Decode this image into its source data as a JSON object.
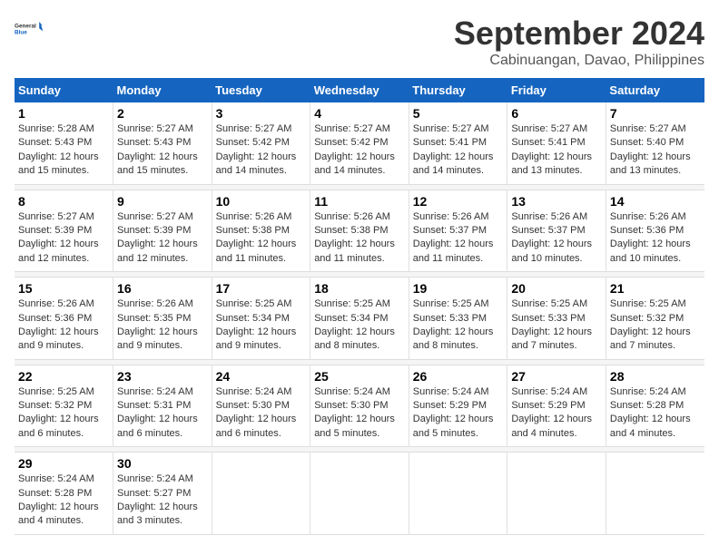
{
  "app": {
    "name": "General",
    "name2": "Blue"
  },
  "title": "September 2024",
  "subtitle": "Cabinuangan, Davao, Philippines",
  "headers": [
    "Sunday",
    "Monday",
    "Tuesday",
    "Wednesday",
    "Thursday",
    "Friday",
    "Saturday"
  ],
  "weeks": [
    [
      {
        "day": "1",
        "sunrise": "Sunrise: 5:28 AM",
        "sunset": "Sunset: 5:43 PM",
        "daylight": "Daylight: 12 hours and 15 minutes."
      },
      {
        "day": "2",
        "sunrise": "Sunrise: 5:27 AM",
        "sunset": "Sunset: 5:43 PM",
        "daylight": "Daylight: 12 hours and 15 minutes."
      },
      {
        "day": "3",
        "sunrise": "Sunrise: 5:27 AM",
        "sunset": "Sunset: 5:42 PM",
        "daylight": "Daylight: 12 hours and 14 minutes."
      },
      {
        "day": "4",
        "sunrise": "Sunrise: 5:27 AM",
        "sunset": "Sunset: 5:42 PM",
        "daylight": "Daylight: 12 hours and 14 minutes."
      },
      {
        "day": "5",
        "sunrise": "Sunrise: 5:27 AM",
        "sunset": "Sunset: 5:41 PM",
        "daylight": "Daylight: 12 hours and 14 minutes."
      },
      {
        "day": "6",
        "sunrise": "Sunrise: 5:27 AM",
        "sunset": "Sunset: 5:41 PM",
        "daylight": "Daylight: 12 hours and 13 minutes."
      },
      {
        "day": "7",
        "sunrise": "Sunrise: 5:27 AM",
        "sunset": "Sunset: 5:40 PM",
        "daylight": "Daylight: 12 hours and 13 minutes."
      }
    ],
    [
      {
        "day": "8",
        "sunrise": "Sunrise: 5:27 AM",
        "sunset": "Sunset: 5:39 PM",
        "daylight": "Daylight: 12 hours and 12 minutes."
      },
      {
        "day": "9",
        "sunrise": "Sunrise: 5:27 AM",
        "sunset": "Sunset: 5:39 PM",
        "daylight": "Daylight: 12 hours and 12 minutes."
      },
      {
        "day": "10",
        "sunrise": "Sunrise: 5:26 AM",
        "sunset": "Sunset: 5:38 PM",
        "daylight": "Daylight: 12 hours and 11 minutes."
      },
      {
        "day": "11",
        "sunrise": "Sunrise: 5:26 AM",
        "sunset": "Sunset: 5:38 PM",
        "daylight": "Daylight: 12 hours and 11 minutes."
      },
      {
        "day": "12",
        "sunrise": "Sunrise: 5:26 AM",
        "sunset": "Sunset: 5:37 PM",
        "daylight": "Daylight: 12 hours and 11 minutes."
      },
      {
        "day": "13",
        "sunrise": "Sunrise: 5:26 AM",
        "sunset": "Sunset: 5:37 PM",
        "daylight": "Daylight: 12 hours and 10 minutes."
      },
      {
        "day": "14",
        "sunrise": "Sunrise: 5:26 AM",
        "sunset": "Sunset: 5:36 PM",
        "daylight": "Daylight: 12 hours and 10 minutes."
      }
    ],
    [
      {
        "day": "15",
        "sunrise": "Sunrise: 5:26 AM",
        "sunset": "Sunset: 5:36 PM",
        "daylight": "Daylight: 12 hours and 9 minutes."
      },
      {
        "day": "16",
        "sunrise": "Sunrise: 5:26 AM",
        "sunset": "Sunset: 5:35 PM",
        "daylight": "Daylight: 12 hours and 9 minutes."
      },
      {
        "day": "17",
        "sunrise": "Sunrise: 5:25 AM",
        "sunset": "Sunset: 5:34 PM",
        "daylight": "Daylight: 12 hours and 9 minutes."
      },
      {
        "day": "18",
        "sunrise": "Sunrise: 5:25 AM",
        "sunset": "Sunset: 5:34 PM",
        "daylight": "Daylight: 12 hours and 8 minutes."
      },
      {
        "day": "19",
        "sunrise": "Sunrise: 5:25 AM",
        "sunset": "Sunset: 5:33 PM",
        "daylight": "Daylight: 12 hours and 8 minutes."
      },
      {
        "day": "20",
        "sunrise": "Sunrise: 5:25 AM",
        "sunset": "Sunset: 5:33 PM",
        "daylight": "Daylight: 12 hours and 7 minutes."
      },
      {
        "day": "21",
        "sunrise": "Sunrise: 5:25 AM",
        "sunset": "Sunset: 5:32 PM",
        "daylight": "Daylight: 12 hours and 7 minutes."
      }
    ],
    [
      {
        "day": "22",
        "sunrise": "Sunrise: 5:25 AM",
        "sunset": "Sunset: 5:32 PM",
        "daylight": "Daylight: 12 hours and 6 minutes."
      },
      {
        "day": "23",
        "sunrise": "Sunrise: 5:24 AM",
        "sunset": "Sunset: 5:31 PM",
        "daylight": "Daylight: 12 hours and 6 minutes."
      },
      {
        "day": "24",
        "sunrise": "Sunrise: 5:24 AM",
        "sunset": "Sunset: 5:30 PM",
        "daylight": "Daylight: 12 hours and 6 minutes."
      },
      {
        "day": "25",
        "sunrise": "Sunrise: 5:24 AM",
        "sunset": "Sunset: 5:30 PM",
        "daylight": "Daylight: 12 hours and 5 minutes."
      },
      {
        "day": "26",
        "sunrise": "Sunrise: 5:24 AM",
        "sunset": "Sunset: 5:29 PM",
        "daylight": "Daylight: 12 hours and 5 minutes."
      },
      {
        "day": "27",
        "sunrise": "Sunrise: 5:24 AM",
        "sunset": "Sunset: 5:29 PM",
        "daylight": "Daylight: 12 hours and 4 minutes."
      },
      {
        "day": "28",
        "sunrise": "Sunrise: 5:24 AM",
        "sunset": "Sunset: 5:28 PM",
        "daylight": "Daylight: 12 hours and 4 minutes."
      }
    ],
    [
      {
        "day": "29",
        "sunrise": "Sunrise: 5:24 AM",
        "sunset": "Sunset: 5:28 PM",
        "daylight": "Daylight: 12 hours and 4 minutes."
      },
      {
        "day": "30",
        "sunrise": "Sunrise: 5:24 AM",
        "sunset": "Sunset: 5:27 PM",
        "daylight": "Daylight: 12 hours and 3 minutes."
      },
      null,
      null,
      null,
      null,
      null
    ]
  ]
}
